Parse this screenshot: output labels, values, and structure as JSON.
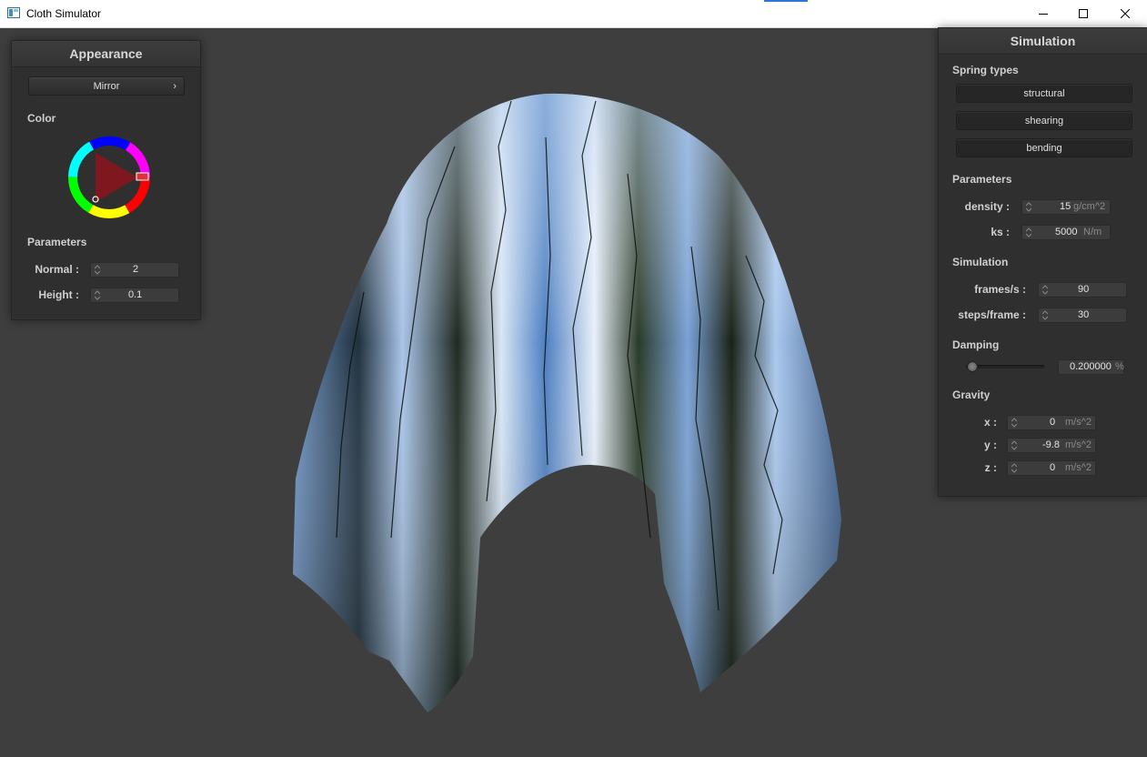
{
  "window": {
    "title": "Cloth Simulator",
    "icons": [
      "app-icon",
      "minimize-icon",
      "maximize-icon",
      "close-icon"
    ]
  },
  "appearance": {
    "header": "Appearance",
    "shader_select": "Mirror",
    "color_label": "Color",
    "color_wheel_selected_hex": "#e0303a",
    "parameters_label": "Parameters",
    "normal_label": "Normal :",
    "normal_value": "2",
    "height_label": "Height :",
    "height_value": "0.1"
  },
  "simulation": {
    "header": "Simulation",
    "spring_types_label": "Spring types",
    "spring_buttons": [
      "structural",
      "shearing",
      "bending"
    ],
    "parameters_label": "Parameters",
    "density_label": "density :",
    "density_value": "15",
    "density_unit": "g/cm^2",
    "ks_label": "ks :",
    "ks_value": "5000",
    "ks_unit": "N/m",
    "simulation_label": "Simulation",
    "fps_label": "frames/s :",
    "fps_value": "90",
    "steps_label": "steps/frame :",
    "steps_value": "30",
    "damping_label": "Damping",
    "damping_value": "0.200000",
    "damping_unit": "%",
    "damping_slider_fraction": 0.08,
    "gravity_label": "Gravity",
    "gx_label": "x :",
    "gx_value": "0",
    "gy_label": "y :",
    "gy_value": "-9.8",
    "gz_label": "z :",
    "gz_value": "0",
    "gravity_unit": "m/s^2"
  },
  "colors": {
    "viewport_bg": "#3e3e3e",
    "panel_bg": "#2f2f2f",
    "cloth_sky": "#4f82c4",
    "cloth_highlight": "#dde8f6"
  }
}
